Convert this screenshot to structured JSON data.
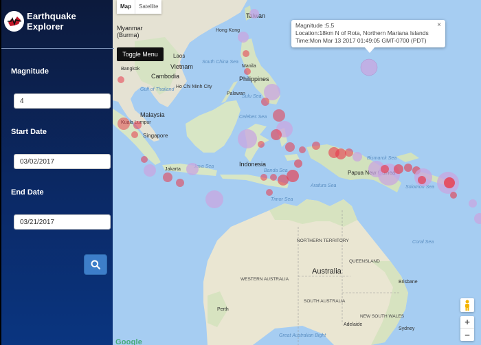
{
  "app": {
    "title": "Earthquake Explorer",
    "icon": "earthquake-logo-icon"
  },
  "form": {
    "magnitude_label": "Magnitude",
    "magnitude_value": "4",
    "magnitude_addon_icon": "info-icon",
    "start_label": "Start Date",
    "start_value": "03/02/2017",
    "end_label": "End Date",
    "end_value": "03/21/2017",
    "calendar_icon": "calendar-icon",
    "search_icon": "search-icon"
  },
  "map": {
    "toggle_menu_label": "Toggle Menu",
    "type_map": "Map",
    "type_satellite": "Satellite",
    "attribution": "Google",
    "zoom_in": "+",
    "zoom_out": "−",
    "labels": {
      "taiwan": "Taiwan",
      "myanmar": "Myanmar",
      "burma": "(Burma)",
      "hong_kong": "Hong Kong",
      "south_china_sea": "South China Sea",
      "vietnam": "Vietnam",
      "laos": "Laos",
      "bangkok": "Bangkok",
      "cambodia": "Cambodia",
      "hcmc": "Ho Chi Minh City",
      "gulf_thailand": "Gulf of Thailand",
      "philippines": "Philippines",
      "manila": "Manila",
      "palawan": "Palawan",
      "sulu_sea": "Sulu Sea",
      "malaysia": "Malaysia",
      "kuala_lumpur": "Kuala Lumpur",
      "singapore": "Singapore",
      "celebes_sea": "Celebes Sea",
      "indonesia": "Indonesia",
      "jakarta": "Jakarta",
      "java_sea": "Java Sea",
      "banda_sea": "Banda Sea",
      "papua_new_guinea": "Papua New Guinea",
      "bismarck_sea": "Bismarck Sea",
      "arafura_sea": "Arafura Sea",
      "solomon_sea": "Solomon Sea",
      "timor_sea": "Timor Sea",
      "coral_sea": "Coral Sea",
      "northern_territory": "NORTHERN TERRITORY",
      "australia": "Australia",
      "queensland": "QUEENSLAND",
      "western_australia": "WESTERN AUSTRALIA",
      "south_australia": "SOUTH AUSTRALIA",
      "brisbane": "Brisbane",
      "perth": "Perth",
      "adelaide": "Adelaide",
      "nsw": "NEW SOUTH WALES",
      "sydney": "Sydney",
      "great_australian_bight": "Great Australian Bight"
    }
  },
  "info_window": {
    "magnitude": "Magnitude :5.5",
    "location": "Location:18km N of Rota, Northern Mariana Islands",
    "time": "Time:Mon Mar 13 2017 01:49:05 GMT-0700 (PDT)",
    "close": "×"
  },
  "colors": {
    "sidebar_top": "#0c1a3c",
    "sidebar_bottom": "#0a3580",
    "accent": "#3d7ec9",
    "ocean": "#a6cdf2",
    "land": "#e8e3d3",
    "marker": "#e8394a"
  }
}
